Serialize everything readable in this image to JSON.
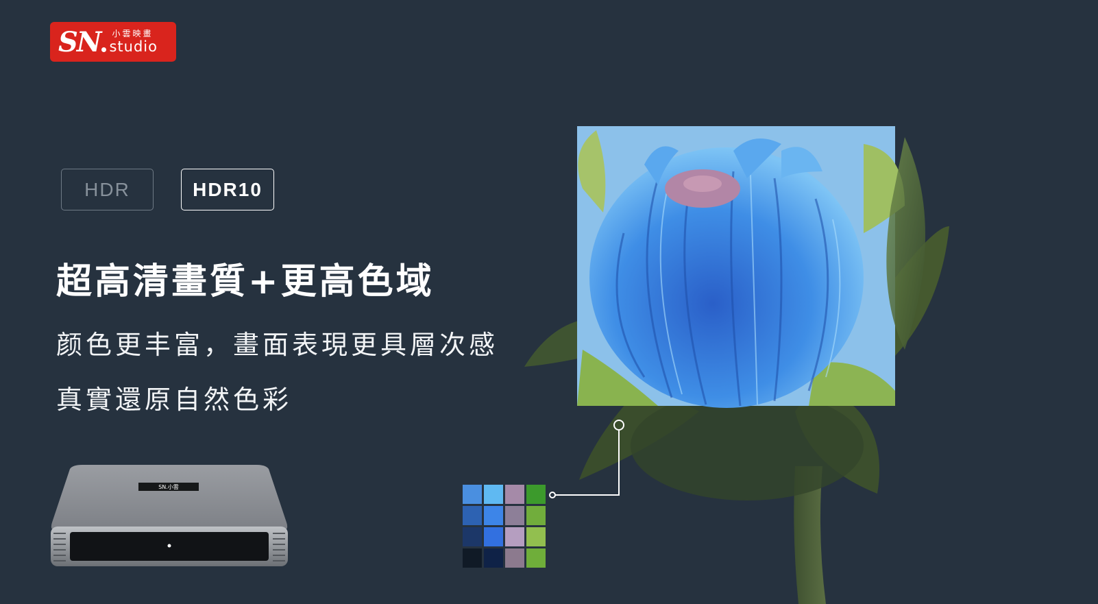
{
  "brand": {
    "mark": "SN",
    "name_cn": "小雲映畫",
    "name_en": "studio",
    "color": "#d9241d"
  },
  "badges": {
    "hdr": "HDR",
    "hdr10": "HDR10"
  },
  "headline": "超高清畫質+更高色域",
  "sublines": [
    "颜色更丰富，畫面表現更具層次感",
    "真實還原自然色彩"
  ],
  "device": {
    "label": "SN.小雲"
  },
  "palette": {
    "colors": [
      "#4a8fe0",
      "#5fb9f2",
      "#a58aa8",
      "#3c9a2c",
      "#2d62b2",
      "#3d85e8",
      "#8d7f98",
      "#71ad3c",
      "#1c3768",
      "#3270e0",
      "#b59ec0",
      "#92bf4f",
      "#101a26",
      "#0f2247",
      "#8c7a8e",
      "#6fae3a"
    ]
  }
}
